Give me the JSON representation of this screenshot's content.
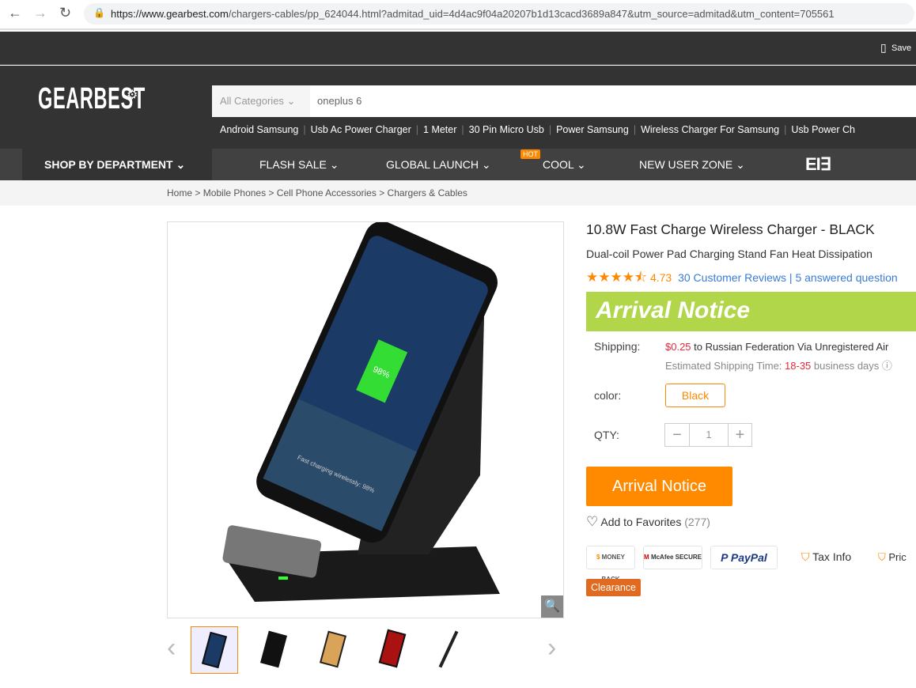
{
  "browser": {
    "url_host": "https://www.gearbest.com",
    "url_path": "/chargers-cables/pp_624044.html?admitad_uid=4d4ac9f04a20207b1d13cacd3689a847&utm_source=admitad&utm_content=705561"
  },
  "topbar": {
    "save_label": "Save"
  },
  "header": {
    "logo": "GEARBEST",
    "category": "All Categories",
    "search_value": "oneplus 6",
    "hot_searches": [
      "Android Samsung",
      "Usb Ac Power Charger",
      "1 Meter",
      "30 Pin Micro Usb",
      "Power Samsung",
      "Wireless Charger For Samsung",
      "Usb Power Ch"
    ]
  },
  "nav": {
    "department": "SHOP BY DEPARTMENT",
    "items": [
      "FLASH SALE",
      "GLOBAL LAUNCH",
      "COOL",
      "NEW USER ZONE"
    ],
    "hot_badge": "HOT",
    "brand_logo": "ELE"
  },
  "breadcrumb": [
    "Home",
    "Mobile Phones",
    "Cell Phone Accessories",
    "Chargers & Cables"
  ],
  "product": {
    "title": "10.8W Fast Charge Wireless Charger - BLACK",
    "subtitle": "Dual-coil Power Pad Charging Stand Fan Heat Dissipation",
    "rating": "4.73",
    "rating_value": 4.73,
    "reviews": "30 Customer Reviews",
    "questions": "5 answered question",
    "banner": "Arrival Notice",
    "shipping_label": "Shipping:",
    "shipping_price": "$0.25",
    "shipping_text": "to Russian Federation Via Unregistered Air",
    "est_label": "Estimated Shipping Time:",
    "est_days": "18-35",
    "est_suffix": "business days",
    "color_label": "color:",
    "color_value": "Black",
    "qty_label": "QTY:",
    "qty": "1",
    "arrival_button": "Arrival Notice",
    "favorites": "Add to Favorites",
    "fav_count": "(277)",
    "badges": [
      "MONEY BACK",
      "McAfee SECURE",
      "PayPal"
    ],
    "tax_info": "Tax Info",
    "price_link": "Pric",
    "clearance": "Clearance",
    "screen_text": "98%",
    "screen_caption": "Fast charging wirelessly: 98%"
  },
  "colors": {
    "accent": "#ff8a00",
    "banner": "#b1d64a",
    "link": "#3a7bd5",
    "price": "#e8283b"
  }
}
